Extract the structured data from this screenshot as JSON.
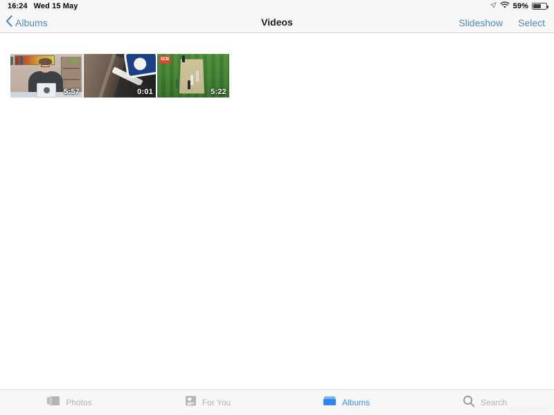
{
  "status_bar": {
    "time": "16:24",
    "date": "Wed 15 May",
    "location_icon": "location-arrow-icon",
    "wifi_icon": "wifi-icon",
    "battery_percent": "59%",
    "battery_level": 59
  },
  "nav_bar": {
    "back_icon": "chevron-left-icon",
    "back_label": "Albums",
    "title": "Videos",
    "slideshow_label": "Slideshow",
    "select_label": "Select",
    "tint_color": "#4a8db7"
  },
  "grid": {
    "items": [
      {
        "name": "video-thumbnail-person-desk",
        "duration": "5:57",
        "description": "Person with glasses seated at a desk holding a tablet"
      },
      {
        "name": "video-thumbnail-road-sign",
        "duration": "0:01",
        "description": "Asphalt road with white line and blue circular sign"
      },
      {
        "name": "video-thumbnail-cricket",
        "duration": "5:22",
        "description": "Cricket pitch with players on green field",
        "overlay_logo": "ECB"
      }
    ]
  },
  "tab_bar": {
    "tabs": [
      {
        "id": "photos",
        "label": "Photos",
        "icon": "photos-stack-icon",
        "active": false
      },
      {
        "id": "for-you",
        "label": "For You",
        "icon": "for-you-heart-card-icon",
        "active": false
      },
      {
        "id": "albums",
        "label": "Albums",
        "icon": "albums-folder-icon",
        "active": true
      },
      {
        "id": "search",
        "label": "Search",
        "icon": "search-magnifier-icon",
        "active": false
      }
    ],
    "active_color": "#3e8ef7",
    "inactive_color": "#b0b0b4"
  },
  "watermark": "wsxdn.com"
}
